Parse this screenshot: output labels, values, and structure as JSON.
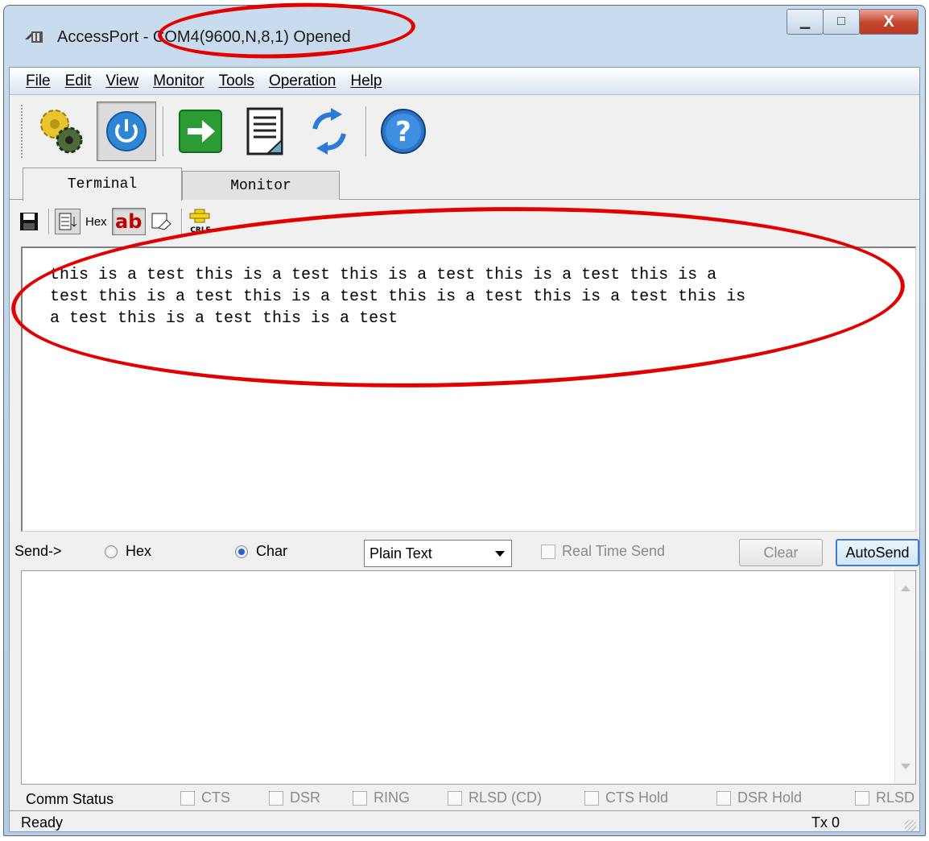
{
  "window": {
    "title_app": "AccessPort - ",
    "title_port": "COM4(9600,N,8,1) Opened",
    "controls": {
      "minimize": "▁",
      "maximize": "□",
      "close": "X"
    }
  },
  "menu": {
    "items": [
      "File",
      "Edit",
      "View",
      "Monitor",
      "Tools",
      "Operation",
      "Help"
    ]
  },
  "toolbar": {
    "buttons": [
      "settings-gears-icon",
      "power-icon",
      "go-arrow-icon",
      "document-icon",
      "refresh-arrows-icon",
      "help-icon"
    ]
  },
  "tabs": {
    "terminal": "Terminal",
    "monitor": "Monitor"
  },
  "subtoolbar": {
    "hex_label": "Hex",
    "ab_label": "ab",
    "crlf_label": "CRLF"
  },
  "terminal": {
    "lines": [
      "this is a test this is a test this is a test this is a test this is a",
      "test this is a test this is a test this is a test this is a test this is",
      "a test this is a test this is a test"
    ]
  },
  "send": {
    "label": "Send->",
    "hex_option": "Hex",
    "char_option": "Char",
    "selected_mode": "Char",
    "format_value": "Plain Text",
    "realtime_label": "Real Time Send",
    "clear_label": "Clear",
    "autosend_label": "AutoSend"
  },
  "comm": {
    "label": "Comm Status",
    "flags": [
      "CTS",
      "DSR",
      "RING",
      "RLSD (CD)",
      "CTS Hold",
      "DSR Hold",
      "RLSD"
    ]
  },
  "status": {
    "ready": "Ready",
    "tx": "Tx 0"
  },
  "annotation": {
    "color": "#e30000"
  }
}
